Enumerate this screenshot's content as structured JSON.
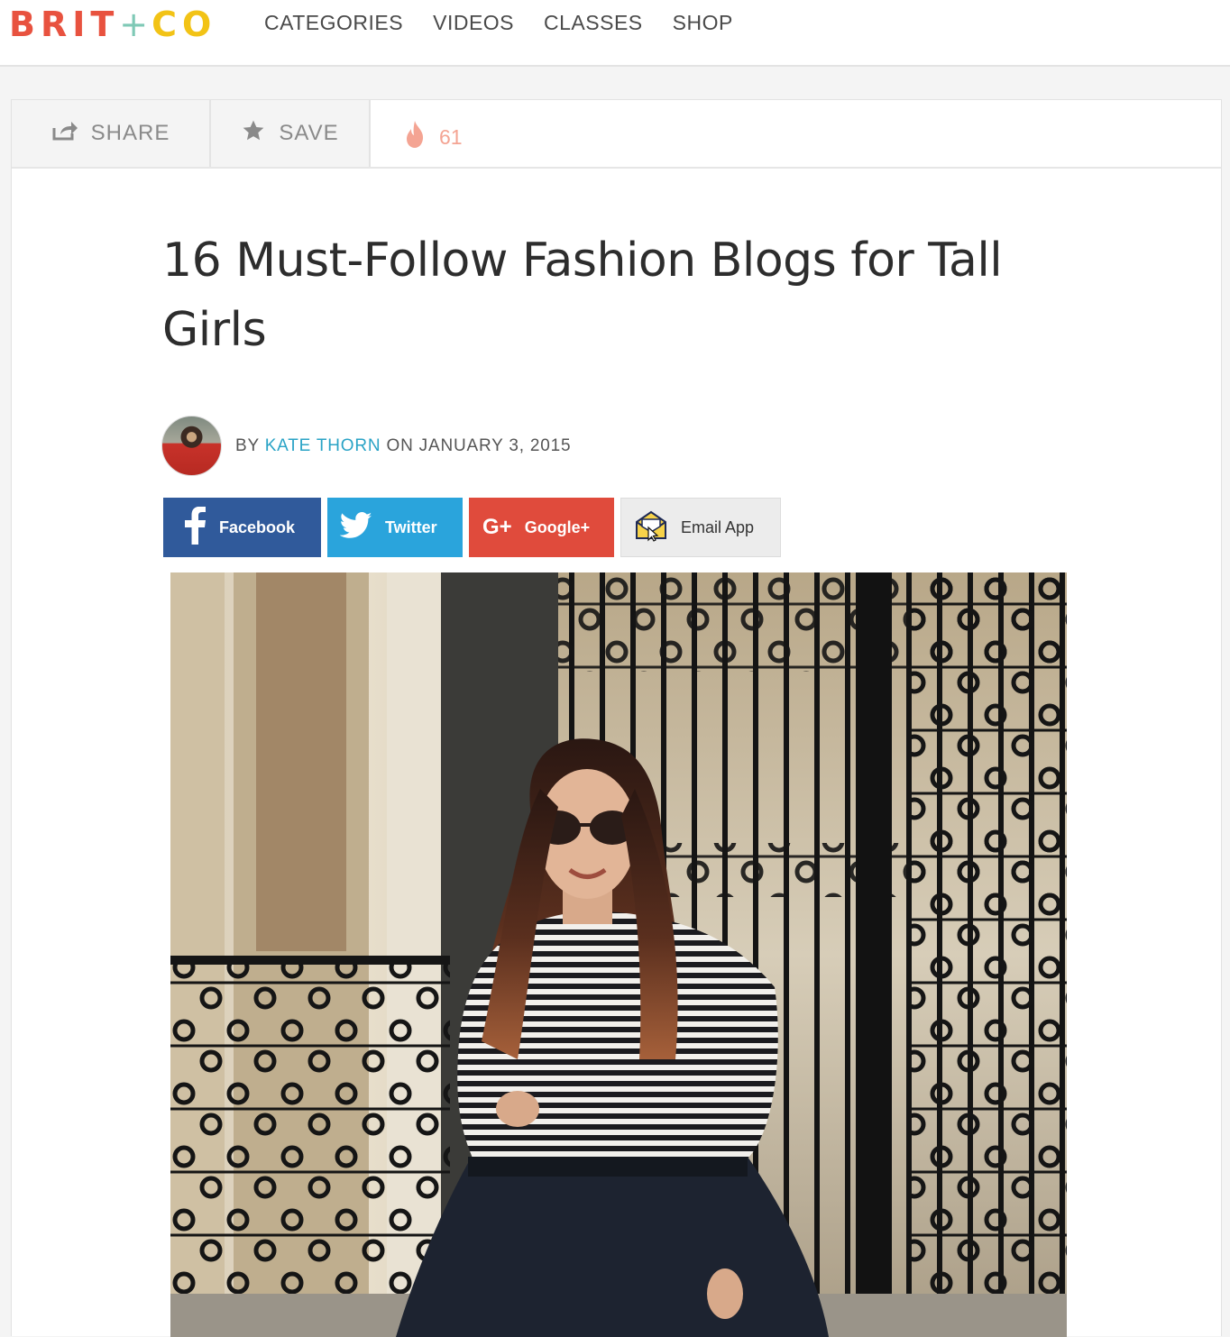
{
  "logo": {
    "part1": "BRIT",
    "plus": "+",
    "part2": "CO"
  },
  "nav": [
    "CATEGORIES",
    "VIDEOS",
    "CLASSES",
    "SHOP"
  ],
  "actions": {
    "share": "SHARE",
    "save": "SAVE",
    "trending_count": "61"
  },
  "article": {
    "title": "16 Must-Follow Fashion Blogs for Tall Girls",
    "byline": {
      "by": "BY",
      "author": "KATE THORN",
      "on": "ON JANUARY 3, 2015"
    }
  },
  "share_buttons": {
    "facebook": "Facebook",
    "twitter": "Twitter",
    "google": "Google+",
    "email": "Email App"
  },
  "colors": {
    "facebook": "#305a9b",
    "twitter": "#2aa4dc",
    "google": "#e04b3c",
    "author_link": "#2aa3c6",
    "logo_red": "#e8523f",
    "logo_teal": "#7fc9b6",
    "logo_yellow": "#f2c316"
  }
}
